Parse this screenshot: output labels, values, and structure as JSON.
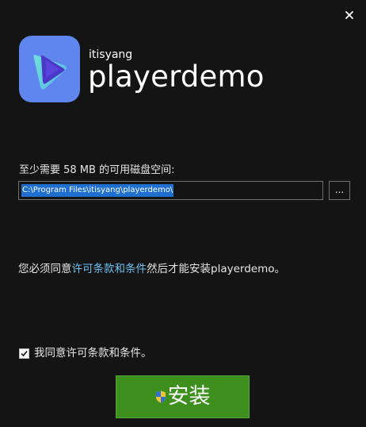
{
  "header": {
    "vendor": "itisyang",
    "app_name": "playerdemo"
  },
  "install_dir": {
    "disk_requirement": "至少需要 58 MB 的可用磁盘空间:",
    "path": "C:\\Program Files\\itisyang\\playerdemo\\",
    "browse_label": "..."
  },
  "license": {
    "prefix": "您必须同意",
    "link": "许可条款和条件",
    "suffix": "然后才能安装playerdemo。"
  },
  "agreement": {
    "checked": true,
    "label": "我同意许可条款和条件。"
  },
  "install_button": {
    "label": "安装"
  },
  "colors": {
    "background": "#141414",
    "accent_link": "#6ec1f0",
    "install_green": "#3d8f1e",
    "logo_blue": "#5e86ee"
  },
  "icons": {
    "close": "close-icon",
    "logo": "play-icon",
    "checkbox": "check-icon",
    "install": "uac-shield-icon"
  }
}
